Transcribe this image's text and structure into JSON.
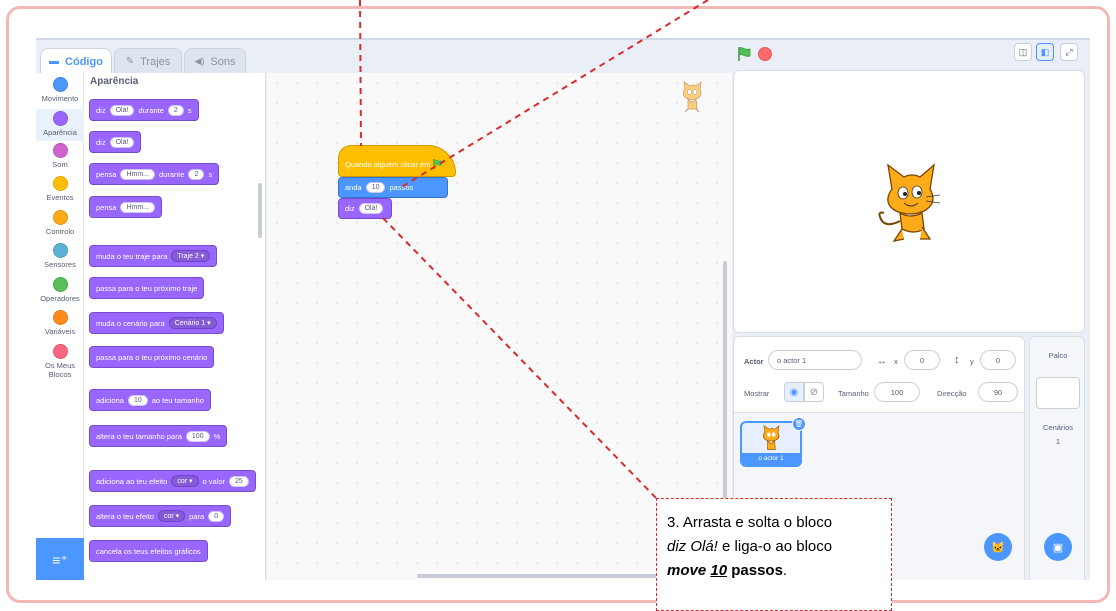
{
  "tabs": [
    {
      "label": "Código",
      "icon": "code-icon"
    },
    {
      "label": "Trajes",
      "icon": "brush-icon"
    },
    {
      "label": "Sons",
      "icon": "speaker-icon"
    }
  ],
  "categories": [
    {
      "label": "Movimento",
      "color": "#4c97ff"
    },
    {
      "label": "Aparência",
      "color": "#9966ff"
    },
    {
      "label": "Som",
      "color": "#cf63cf"
    },
    {
      "label": "Eventos",
      "color": "#ffbf00"
    },
    {
      "label": "Controlo",
      "color": "#ffab19"
    },
    {
      "label": "Sensores",
      "color": "#5cb1d6"
    },
    {
      "label": "Operadores",
      "color": "#59c059"
    },
    {
      "label": "Variáveis",
      "color": "#ff8c1a"
    },
    {
      "label": "Os Meus Blocos",
      "color": "#ff6680"
    }
  ],
  "palette": {
    "title": "Aparência",
    "b1": {
      "t1": "diz",
      "p1": "Olá!",
      "t2": "durante",
      "p2": "2",
      "t3": "s"
    },
    "b2": {
      "t1": "diz",
      "p1": "Olá!"
    },
    "b3": {
      "t1": "pensa",
      "p1": "Hmm...",
      "t2": "durante",
      "p2": "2",
      "t3": "s"
    },
    "b4": {
      "t1": "pensa",
      "p1": "Hmm..."
    },
    "b5": {
      "t1": "muda o teu traje para",
      "d1": "Traje 2 ▾"
    },
    "b6": {
      "t1": "passa para o teu próximo traje"
    },
    "b7": {
      "t1": "muda o cenário para",
      "d1": "Cenário 1 ▾"
    },
    "b8": {
      "t1": "passa para o teu próximo cenário"
    },
    "b9": {
      "t1": "adiciona",
      "p1": "10",
      "t2": "ao teu tamanho"
    },
    "b10": {
      "t1": "altera o teu tamanho para",
      "p1": "100",
      "t2": "%"
    },
    "b11": {
      "t1": "adiciona ao teu efeito",
      "d1": "cor ▾",
      "t2": "o valor",
      "p1": "25"
    },
    "b12": {
      "t1": "altera o teu efeito",
      "d1": "cor ▾",
      "t2": "para",
      "p1": "0"
    },
    "b13": {
      "t1": "cancela os teus efeitos gráficos"
    }
  },
  "script": {
    "hat_label": "Quando alguém clicar em",
    "move": {
      "t1": "anda",
      "p1": "10",
      "t2": "passos"
    },
    "say": {
      "t1": "diz",
      "p1": "Olá!"
    }
  },
  "sprite_info": {
    "actor_label": "Actor",
    "actor_name": "o actor 1",
    "x_label": "x",
    "x_value": "0",
    "y_label": "y",
    "y_value": "0",
    "show_label": "Mostrar",
    "size_label": "Tamanho",
    "size_value": "100",
    "direction_label": "Direcção",
    "direction_value": "90",
    "thumb_name": "o actor 1"
  },
  "stage_panel": {
    "title": "Palco",
    "backdrops_label": "Cenários",
    "backdrops_count": "1"
  },
  "callout": {
    "line1": "3. Arrasta e solta o bloco",
    "em1": "diz Olá!",
    "line2_rest": " e liga-o ao bloco",
    "b_move": "move",
    "b_num": "10",
    "b_passos": "passos",
    "period": "."
  },
  "colors": {
    "accent": "#4c97ff",
    "looks": "#9966ff",
    "events": "#ffbf00",
    "annotation": "#d92b2b"
  }
}
